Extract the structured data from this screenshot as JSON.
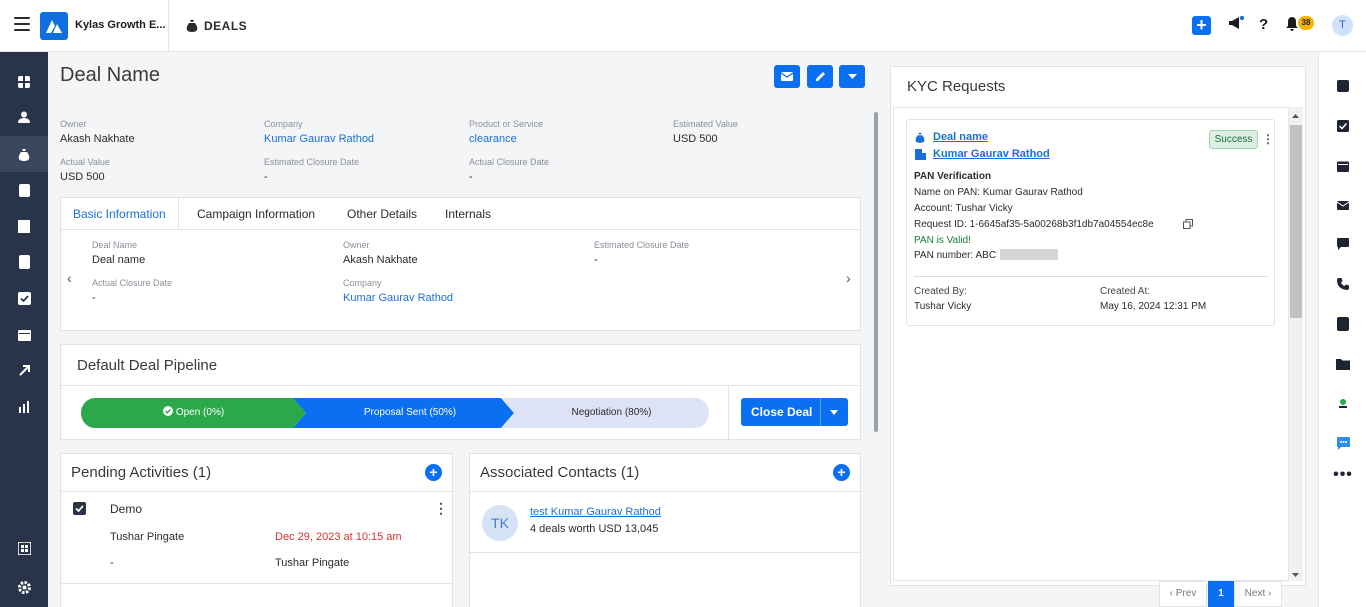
{
  "app": {
    "name": "Kylas Growth E...",
    "module": "DEALS",
    "notification_count": "38",
    "user_initial": "T"
  },
  "deal": {
    "title": "Deal Name",
    "summary": [
      {
        "label": "Owner",
        "value": "Akash Nakhate",
        "link": false
      },
      {
        "label": "Company",
        "value": "Kumar Gaurav Rathod",
        "link": true
      },
      {
        "label": "Product or Service",
        "value": "clearance",
        "link": true
      },
      {
        "label": "Estimated Value",
        "value": "USD 500",
        "link": false
      },
      {
        "label": "Actual Value",
        "value": "USD 500",
        "link": false
      },
      {
        "label": "Estimated Closure Date",
        "value": "-",
        "link": false
      },
      {
        "label": "Actual Closure Date",
        "value": "-",
        "link": false
      }
    ]
  },
  "details_tabs": [
    "Basic Information",
    "Campaign Information",
    "Other Details",
    "Internals"
  ],
  "basic_info": [
    {
      "label": "Deal Name",
      "value": "Deal name"
    },
    {
      "label": "Owner",
      "value": "Akash Nakhate"
    },
    {
      "label": "Estimated Closure Date",
      "value": "-"
    },
    {
      "label": "Actual Closure Date",
      "value": "-"
    },
    {
      "label": "Company",
      "value": "Kumar Gaurav Rathod"
    }
  ],
  "pipeline": {
    "title": "Default Deal Pipeline",
    "stages": [
      "Open (0%)",
      "Proposal Sent (50%)",
      "Negotiation (80%)"
    ],
    "close_label": "Close Deal",
    "colors": {
      "open": "#2ba84a",
      "current": "#0a6ff0",
      "pending": "#dde3f5"
    }
  },
  "activities": {
    "title": "Pending Activities (1)",
    "item": {
      "name": "Demo",
      "assignee": "Tushar Pingate",
      "due": "Dec 29, 2023 at 10:15 am",
      "dash": "-",
      "owner": "Tushar Pingate"
    }
  },
  "contacts": {
    "title": "Associated Contacts (1)",
    "item": {
      "initials": "TK",
      "name": "test Kumar Gaurav Rathod",
      "summary": "4 deals worth USD 13,045"
    }
  },
  "kyc": {
    "title": "KYC Requests",
    "deal_link": "Deal name",
    "company_link": "Kumar Gaurav Rathod",
    "status": "Success",
    "section": "PAN Verification",
    "name_on_pan": "Name on PAN: Kumar Gaurav Rathod",
    "account": "Account: Tushar Vicky",
    "request_id": "Request ID: 1-6645af35-5a00268b3f1db7a04554ec8e",
    "valid": "PAN is Valid!",
    "pan_number": "PAN number: ABC",
    "created_by_label": "Created By:",
    "created_by": "Tushar Vicky",
    "created_at_label": "Created At:",
    "created_at": "May 16, 2024 12:31 PM",
    "pager": {
      "prev": "‹ Prev",
      "page": "1",
      "next": "Next ›"
    }
  }
}
